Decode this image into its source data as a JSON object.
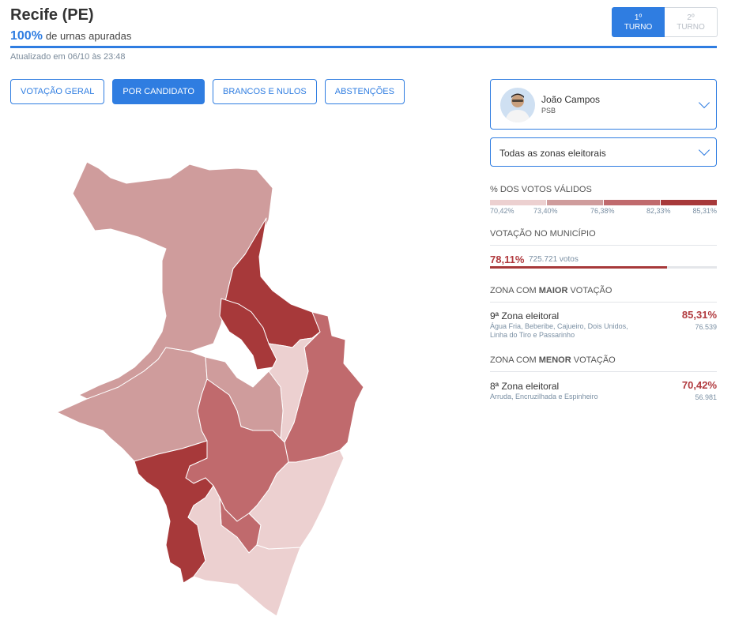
{
  "header": {
    "title": "Recife (PE)",
    "apuradas_pct": "100%",
    "apuradas_label": "de urnas apuradas",
    "updated": "Atualizado em 06/10 às 23:48"
  },
  "turno": {
    "first_num": "1º",
    "first_label": "TURNO",
    "second_num": "2º",
    "second_label": "TURNO"
  },
  "tabs": [
    "VOTAÇÃO GERAL",
    "POR CANDIDATO",
    "BRANCOS E NULOS",
    "ABSTENÇÕES"
  ],
  "active_tab": "POR CANDIDATO",
  "candidate": {
    "name": "João Campos",
    "party": "PSB"
  },
  "zone_filter": "Todas as zonas eleitorais",
  "legend": {
    "title": "% DOS VOTOS VÁLIDOS",
    "ticks": [
      "70,42%",
      "73,40%",
      "76,38%",
      "82,33%",
      "85,31%"
    ],
    "colors": [
      "#ecd0d0",
      "#cf9c9c",
      "#c06a6d",
      "#a7393a"
    ]
  },
  "municipio": {
    "title": "VOTAÇÃO NO MUNICÍPIO",
    "pct": "78,11%",
    "votes": "725.721 votos",
    "fraction": 0.7811
  },
  "maior": {
    "title_pre": "ZONA COM",
    "title_bold": "MAIOR",
    "title_post": "VOTAÇÃO",
    "zone": "9ª Zona eleitoral",
    "pct": "85,31%",
    "votes": "76.539",
    "areas": "Água Fria, Beberibe, Cajueiro, Dois Unidos, Linha do Tiro e Passarinho"
  },
  "menor": {
    "title_pre": "ZONA COM",
    "title_bold": "MENOR",
    "title_post": "VOTAÇÃO",
    "zone": "8ª Zona eleitoral",
    "pct": "70,42%",
    "votes": "56.981",
    "areas": "Arruda, Encruzilhada e Espinheiro"
  }
}
